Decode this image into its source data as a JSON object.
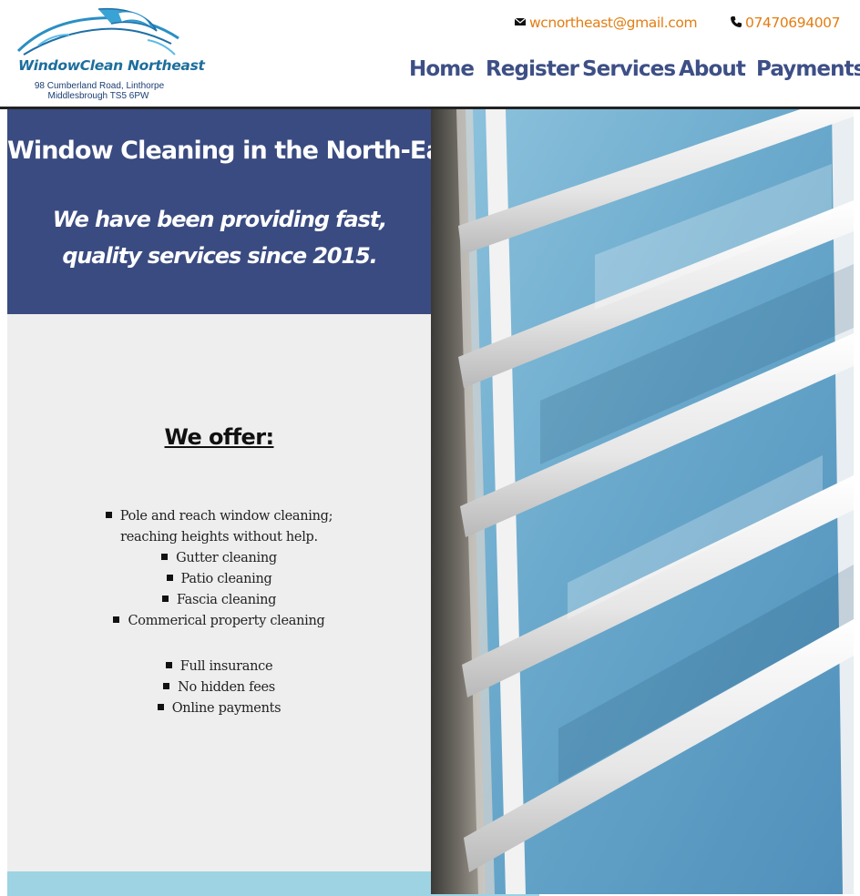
{
  "brand": {
    "name": "WindowClean Northeast",
    "address_line1": "98 Cumberland Road, Linthorpe",
    "address_line2": "Middlesbrough TS5 6PW",
    "logo_icon": "wave-logo-icon"
  },
  "contact": {
    "email": "wcnortheast@gmail.com",
    "email_icon": "envelope-icon",
    "phone": "07470694007",
    "phone_icon": "phone-icon"
  },
  "nav": {
    "items": [
      "Home",
      "Register",
      "Services",
      "About",
      "Payments"
    ]
  },
  "hero": {
    "title": "Window Cleaning in the North-East",
    "subtitle": "We have been providing fast, quality services since 2015."
  },
  "offers": {
    "heading": "We offer:",
    "services": [
      {
        "label": "Pole and reach window cleaning;",
        "continuation": "reaching heights without help."
      },
      {
        "label": "Gutter cleaning"
      },
      {
        "label": "Patio cleaning"
      },
      {
        "label": "Fascia cleaning"
      },
      {
        "label": "Commerical property cleaning"
      }
    ],
    "benefits": [
      "Full insurance",
      "No hidden fees",
      "Online payments"
    ]
  },
  "colors": {
    "nav_text": "#3d4f86",
    "hero_bg": "#3a4b81",
    "contact_text": "#e37d12",
    "panel_bg": "#eeeeee",
    "footer_band": "#9dd3e3"
  },
  "photo": {
    "subject": "conservatory-roof-glass-photo"
  }
}
